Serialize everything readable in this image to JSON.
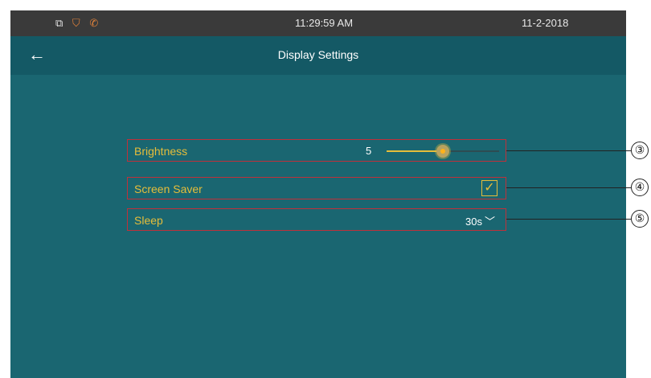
{
  "status_bar": {
    "icons": [
      "window-icon",
      "shield-icon",
      "phone-icon"
    ],
    "time": "11:29:59 AM",
    "date": "11-2-2018"
  },
  "header": {
    "back_icon": "back-arrow-icon",
    "title": "Display Settings"
  },
  "settings": {
    "brightness": {
      "label": "Brightness",
      "value": "5",
      "slider_fraction": 0.5
    },
    "screen_saver": {
      "label": "Screen Saver",
      "checked": true
    },
    "sleep": {
      "label": "Sleep",
      "value": "30s"
    }
  },
  "callouts": [
    "③",
    "④",
    "⑤"
  ],
  "colors": {
    "screen_bg": "#1a6671",
    "header_bg": "#145965",
    "status_bg": "#3a3a3a",
    "accent": "#e6bd3a",
    "highlight_border": "#c0303a"
  }
}
